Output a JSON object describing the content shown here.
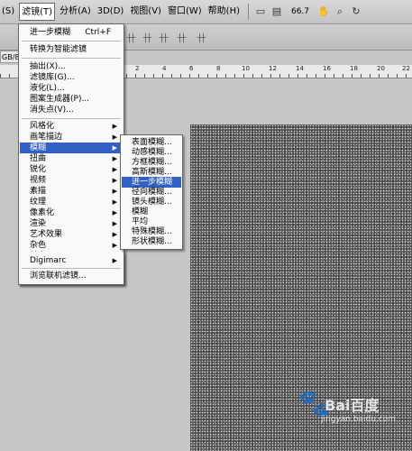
{
  "menubar": {
    "items": [
      {
        "label": "(S)",
        "active": false
      },
      {
        "label": "滤镜(T)",
        "active": true
      },
      {
        "label": "分析(A)",
        "active": false
      },
      {
        "label": "3D(D)",
        "active": false
      },
      {
        "label": "视图(V)",
        "active": false
      },
      {
        "label": "窗口(W)",
        "active": false
      },
      {
        "label": "帮助(H)",
        "active": false
      }
    ],
    "zoom": "66.7"
  },
  "document_tab": "GB/8",
  "ruler_numbers": [
    "2",
    "4",
    "6",
    "8",
    "10",
    "12",
    "14",
    "16",
    "18",
    "20",
    "22"
  ],
  "filter_menu": {
    "items": [
      {
        "label": "进一步模糊",
        "shortcut": "Ctrl+F"
      },
      {
        "label": "转换为智能滤镜"
      },
      {
        "label": "抽出(X)..."
      },
      {
        "label": "滤镜库(G)..."
      },
      {
        "label": "液化(L)..."
      },
      {
        "label": "图案生成器(P)..."
      },
      {
        "label": "消失点(V)..."
      },
      {
        "label": "风格化",
        "submenu": true
      },
      {
        "label": "画笔描边",
        "submenu": true
      },
      {
        "label": "模糊",
        "submenu": true,
        "highlighted": true
      },
      {
        "label": "扭曲",
        "submenu": true
      },
      {
        "label": "锐化",
        "submenu": true
      },
      {
        "label": "视频",
        "submenu": true
      },
      {
        "label": "素描",
        "submenu": true
      },
      {
        "label": "纹理",
        "submenu": true
      },
      {
        "label": "像素化",
        "submenu": true
      },
      {
        "label": "渲染",
        "submenu": true
      },
      {
        "label": "艺术效果",
        "submenu": true
      },
      {
        "label": "杂色",
        "submenu": true
      },
      {
        "label": "其它",
        "submenu": true
      },
      {
        "label": "Digimarc",
        "submenu": true
      },
      {
        "label": "浏览联机滤镜..."
      }
    ]
  },
  "blur_submenu": {
    "items": [
      {
        "label": "表面模糊..."
      },
      {
        "label": "动感模糊..."
      },
      {
        "label": "方框模糊..."
      },
      {
        "label": "高斯模糊..."
      },
      {
        "label": "进一步模糊",
        "highlighted": true
      },
      {
        "label": "径向模糊..."
      },
      {
        "label": "镜头模糊..."
      },
      {
        "label": "模糊"
      },
      {
        "label": "平均"
      },
      {
        "label": "特殊模糊..."
      },
      {
        "label": "形状模糊..."
      }
    ]
  },
  "watermark": {
    "text": "Bai百度",
    "subtext": "jingyan.baidu.com"
  },
  "colors": {
    "highlight": "#3161c4",
    "menu_bg": "#f9f9f9",
    "workspace": "#c6c6c6"
  }
}
